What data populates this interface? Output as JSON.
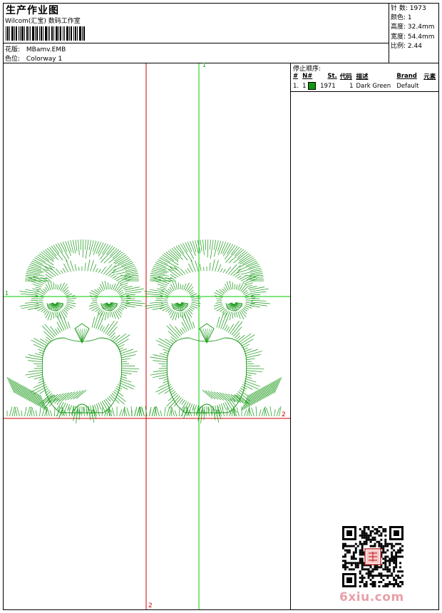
{
  "header": {
    "title": "生产作业图",
    "company": "Wilcom(汇宝) 数码工作室",
    "design_label": "花版:",
    "design_file": "MBamv.EMB",
    "colorway_label": "色位:",
    "colorway": "Colorway 1"
  },
  "stats": [
    {
      "label": "针 数:",
      "value": "1973"
    },
    {
      "label": "颜色:",
      "value": "1"
    },
    {
      "label": "高度:",
      "value": "32.4mm"
    },
    {
      "label": "宽度:",
      "value": "54.4mm"
    },
    {
      "label": "比例:",
      "value": "2.44"
    }
  ],
  "stop_sequence": {
    "title": "停止顺序:",
    "columns": [
      "#",
      "N#",
      "St.",
      "代码",
      "描述",
      "Brand",
      "元素"
    ],
    "rows": [
      {
        "num": "1.",
        "needle": "1",
        "color": "#129612",
        "stitches": "1971",
        "code": "1",
        "description": "Dark Green",
        "brand": "Default",
        "element": ""
      }
    ]
  },
  "guides": {
    "axis1_label": "1",
    "axis2_label": "2",
    "left_label": "1",
    "right_label": "2"
  },
  "colors": {
    "thread": "#129612",
    "guide_green": "#00cc00",
    "guide_red": "#cc0000"
  },
  "watermark": "6xiu.com",
  "stamp_text": "以修 工作室"
}
